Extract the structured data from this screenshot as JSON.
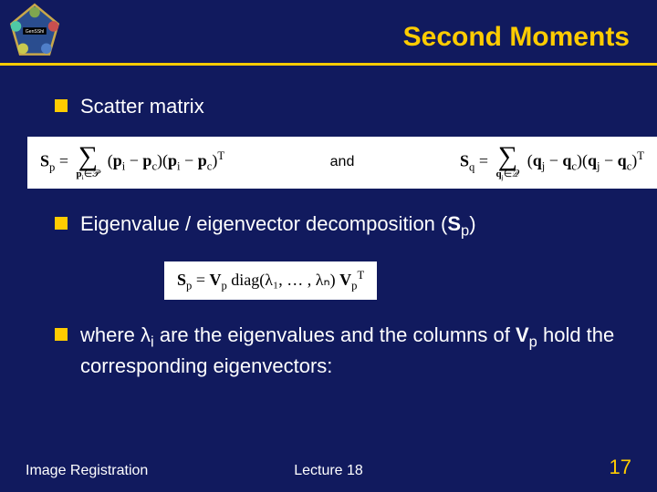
{
  "header": {
    "title": "Second Moments",
    "logo_label": "GenSShl"
  },
  "bullets": {
    "b1": "Scatter matrix",
    "b2_pre": "Eigenvalue / eigenvector decomposition (",
    "b2_S": "S",
    "b2_sub": "p",
    "b2_post": ")",
    "b3_pre": "where λ",
    "b3_isub": "i",
    "b3_mid": " are the eigenvalues and the columns of ",
    "b3_V": "V",
    "b3_vsub": "p",
    "b3_post": " hold the corresponding eigenvectors:"
  },
  "equations": {
    "eq1_lhs_sym": "S",
    "eq1_lhs_sub": "p",
    "eq1_eq": " = ",
    "eq1_sum_below": "pᵢ∈𝒫",
    "eq1_body": "(pᵢ − p_c)(pᵢ − p_c)ᵀ",
    "and": "and",
    "eq1b_lhs_sym": "S",
    "eq1b_lhs_sub": "q",
    "eq1b_sum_below": "qⱼ∈𝒬",
    "eq1b_body": "(qⱼ − q_c)(qⱼ − q_c)ᵀ",
    "eq2_lhs_sym": "S",
    "eq2_lhs_sub": "p",
    "eq2_rhs_V": "V",
    "eq2_rhs_Vsub": "p",
    "eq2_diag": " diag(λ₁, … , λₙ) ",
    "eq2_rhs_V2": "V",
    "eq2_rhs_V2sub": "p",
    "eq2_rhs_V2sup": "T"
  },
  "footer": {
    "left": "Image Registration",
    "center": "Lecture 18",
    "right": "17"
  }
}
